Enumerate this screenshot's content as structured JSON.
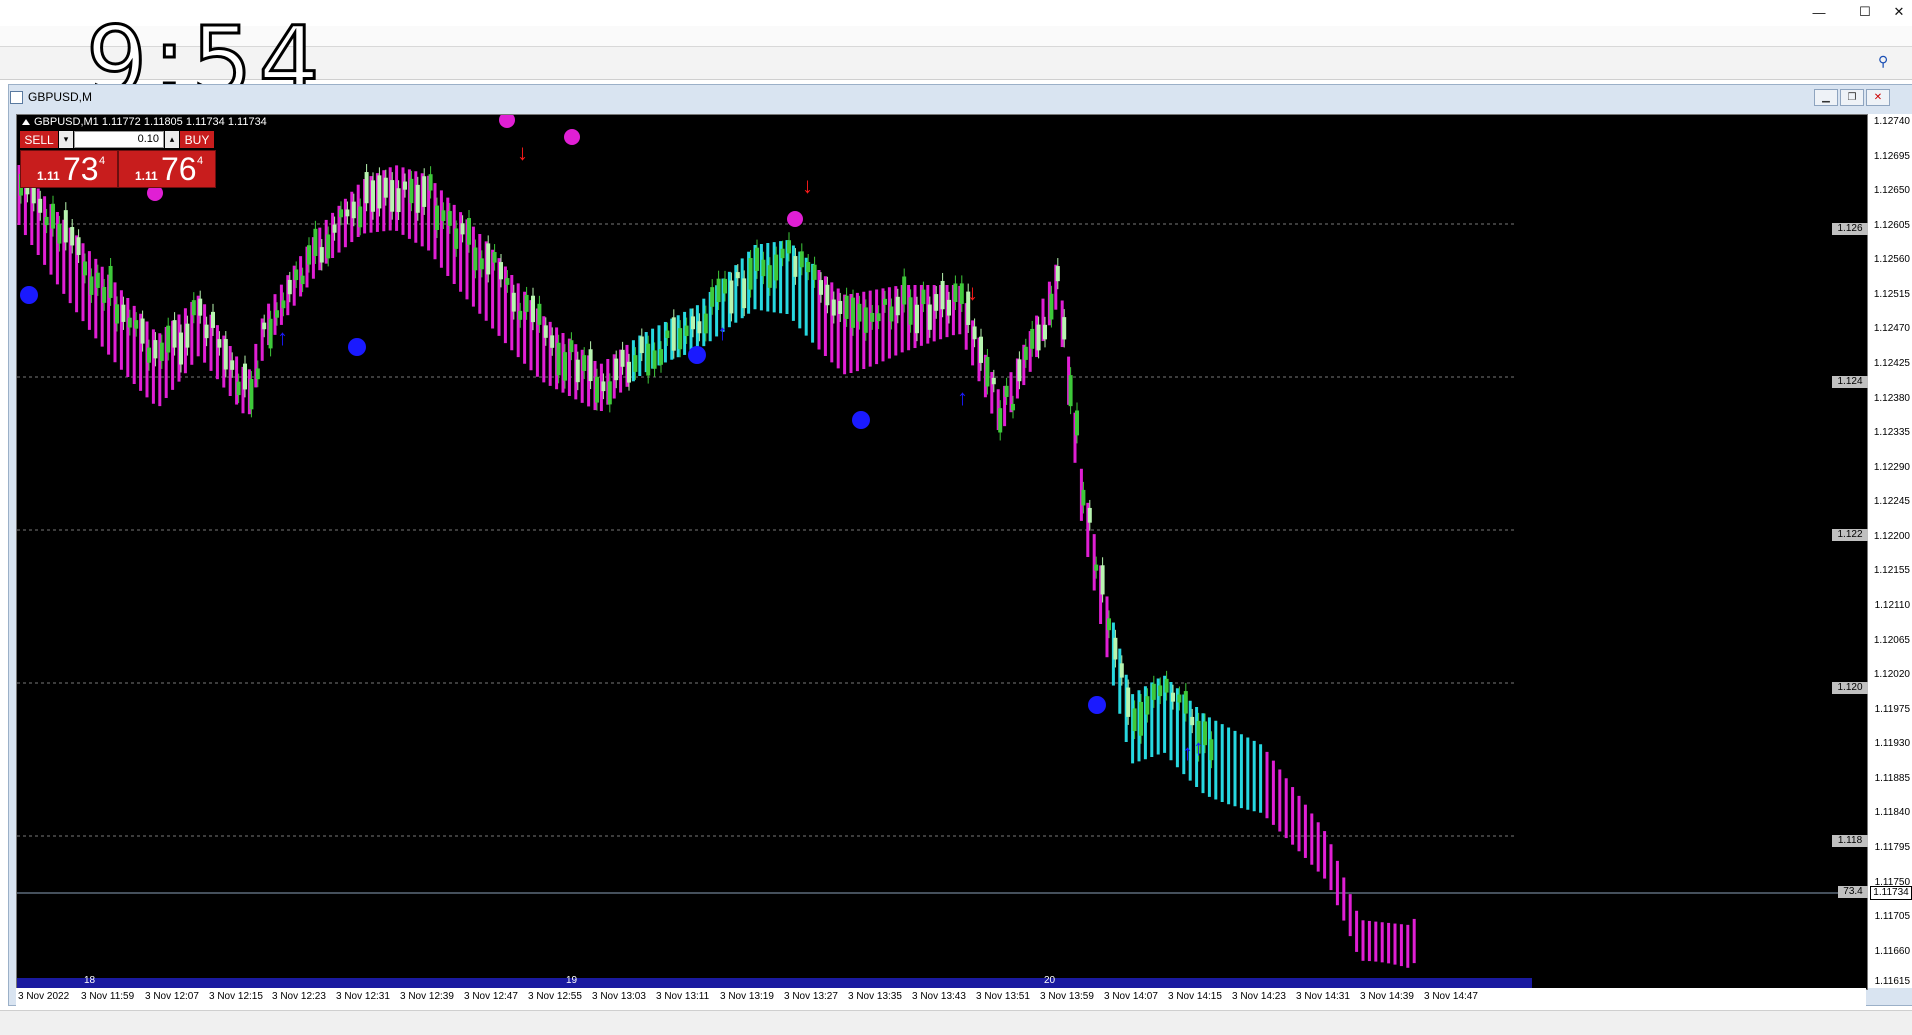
{
  "clock": "9:54",
  "window_controls": {
    "minimize": "—",
    "maximize": "☐",
    "close": "✕"
  },
  "chart_tab": {
    "title": "GBPUSD,M"
  },
  "symbol_info": "GBPUSD,M1  1.11772 1.11805 1.11734 1.11734",
  "trade_panel": {
    "sell_label": "SELL",
    "buy_label": "BUY",
    "volume": "0.10",
    "sell_price_small": "1.11",
    "sell_price_big": "73",
    "sell_price_sup": "4",
    "buy_price_small": "1.11",
    "buy_price_big": "76",
    "buy_price_sup": "4"
  },
  "price_ticks": [
    "1.12740",
    "1.12695",
    "1.12650",
    "1.12605",
    "1.12560",
    "1.12515",
    "1.12470",
    "1.12425",
    "1.12380",
    "1.12335",
    "1.12290",
    "1.12245",
    "1.12200",
    "1.12155",
    "1.12110",
    "1.12065",
    "1.12020",
    "1.11975",
    "1.11930",
    "1.11885",
    "1.11840",
    "1.11795",
    "1.11750",
    "1.11705",
    "1.11660",
    "1.11615"
  ],
  "level_labels": [
    "1.126",
    "1.124",
    "1.122",
    "1.120",
    "1.118"
  ],
  "bid_label": "1.11734",
  "bid_tag": "73.4",
  "time_labels": [
    "3 Nov 2022",
    "3 Nov 11:59",
    "3 Nov 12:07",
    "3 Nov 12:15",
    "3 Nov 12:23",
    "3 Nov 12:31",
    "3 Nov 12:39",
    "3 Nov 12:47",
    "3 Nov 12:55",
    "3 Nov 13:03",
    "3 Nov 13:11",
    "3 Nov 13:19",
    "3 Nov 13:27",
    "3 Nov 13:35",
    "3 Nov 13:43",
    "3 Nov 13:51",
    "3 Nov 13:59",
    "3 Nov 14:07",
    "3 Nov 14:15",
    "3 Nov 14:23",
    "3 Nov 14:31",
    "3 Nov 14:39",
    "3 Nov 14:47"
  ],
  "period_labels": [
    "18",
    "19",
    "20"
  ],
  "colors": {
    "background": "#000000",
    "bull_candle": "#b8f5b0",
    "bear_candle": "#3ec93a",
    "band_bear": "#e01fd4",
    "band_bull": "#27d8e0",
    "arrow_up": "#1a1aff",
    "arrow_down": "#ff1a1a",
    "trade_red": "#c81d1d"
  },
  "icons": [
    "minimize-icon",
    "maximize-icon",
    "close-icon",
    "chart-tab-icon",
    "search-icon",
    "arrow-up-icon",
    "arrow-down-icon"
  ]
}
